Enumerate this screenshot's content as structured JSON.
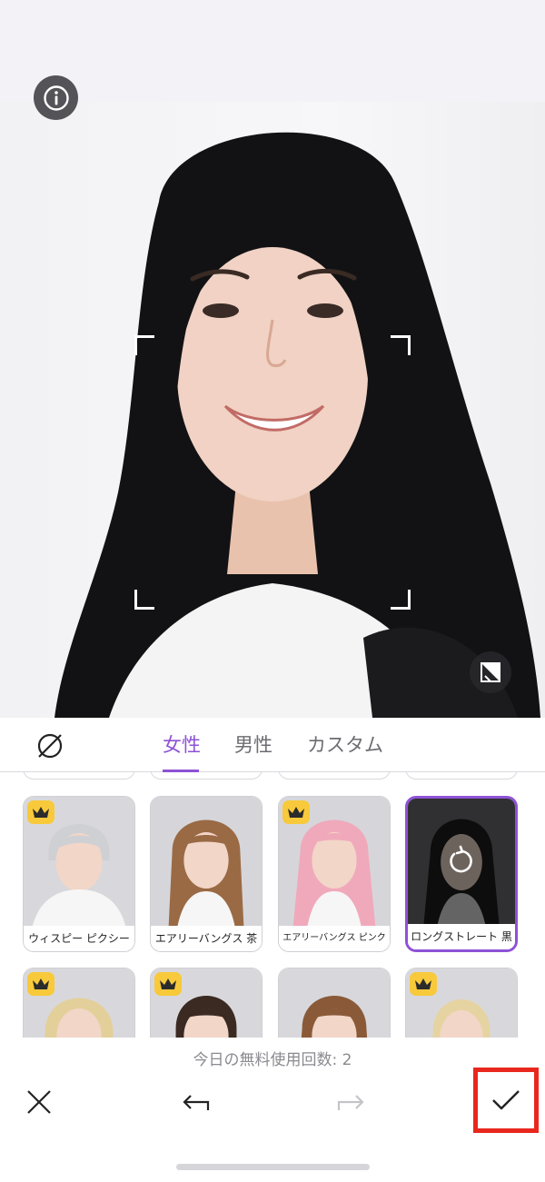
{
  "photo": {
    "info_icon": "info-icon",
    "compare_icon": "compare-icon"
  },
  "tabs": {
    "none_icon": "no-style-icon",
    "items": [
      {
        "label": "女性",
        "active": true
      },
      {
        "label": "男性",
        "active": false
      },
      {
        "label": "カスタム",
        "active": false
      }
    ]
  },
  "styles": {
    "row1": [
      {
        "label": "ウィスピー ピクシー",
        "premium": true,
        "selected": false,
        "hair": "#cfd0d4"
      },
      {
        "label": "エアリーバングス 茶",
        "premium": false,
        "selected": false,
        "hair": "#9a6a45"
      },
      {
        "label": "エアリーバングス ピンク",
        "premium": true,
        "selected": false,
        "hair": "#f0a9bb"
      },
      {
        "label": "ロングストレート 黒",
        "premium": false,
        "selected": true,
        "hair": "#151515"
      }
    ],
    "row2": [
      {
        "premium": true,
        "hair": "#e3cf9a"
      },
      {
        "premium": true,
        "hair": "#3b2a22"
      },
      {
        "premium": false,
        "hair": "#8a5a38"
      },
      {
        "premium": true,
        "hair": "#e6d3a2"
      }
    ]
  },
  "footer": {
    "free_count_text": "今日の無料使用回数: 2",
    "cancel_icon": "close-icon",
    "undo_icon": "undo-icon",
    "redo_icon": "redo-icon",
    "confirm_icon": "check-icon"
  },
  "colors": {
    "accent": "#8e52d6",
    "premium": "#f8c93a",
    "highlight_box": "#e8281e"
  }
}
